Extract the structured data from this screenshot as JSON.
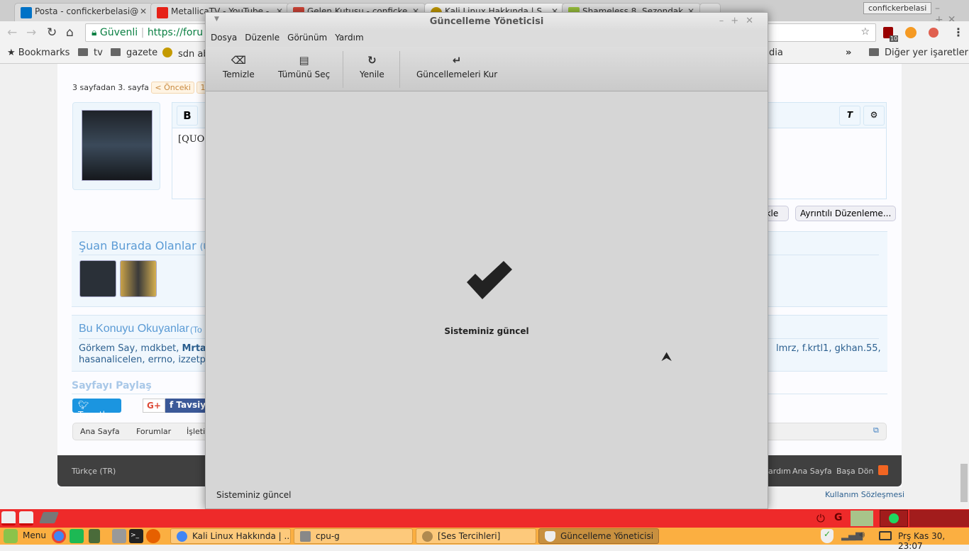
{
  "browser": {
    "tabs": [
      {
        "title": "Posta - confickerbelasi@",
        "icon": "outlook-icon",
        "color": "#0072c6"
      },
      {
        "title": "MetallicaTV - YouTube -",
        "icon": "youtube-icon",
        "color": "#e62117"
      },
      {
        "title": "Gelen Kutusu - conficke",
        "icon": "gmail-icon",
        "color": "#d44638"
      },
      {
        "title": "Kali Linux Hakkında | S",
        "icon": "kali-icon",
        "color": "#c49a00"
      },
      {
        "title": "Shameless 8. Sezondak",
        "icon": "dizi-icon",
        "color": "#9ac23c"
      }
    ],
    "profile": "confickerbelasi",
    "omnibox": {
      "secure_label": "Güvenli",
      "url": "https://foru"
    },
    "bookmarks": [
      "Bookmarks",
      "tv",
      "gazete",
      "sdn ab",
      "dia"
    ],
    "other_bookmarks": "Diğer yer işaretleri",
    "ext_badge": "10"
  },
  "forum": {
    "page_info": "3 sayfadan 3. sayfa",
    "prev": "< Önceki",
    "page1": "1",
    "editor_text": "[QUO",
    "bold": "B",
    "buttons": {
      "upload": "ükle",
      "advanced": "Ayrıntılı Düzenleme..."
    },
    "online_title": "Şuan Burada Olanlar",
    "online_sub": "(Üye",
    "readers_title": "Bu Konuyu Okuyanlar",
    "readers_sub": "(To",
    "readers_line1": [
      "Görkem Say, mdkbet, ",
      "Mrtaltg,"
    ],
    "readers_line1_right": "lmrz, f.krtl1, gkhan.55,",
    "readers_line2": "hasanalicelen, errno, izzetpasa",
    "share_title": "Sayfayı Paylaş",
    "tweet": "Tweetle",
    "gplus": "G+",
    "fb": "Tavsiy",
    "breadcrumb": [
      "Ana Sayfa",
      "Forumlar",
      "İşletim"
    ],
    "footer": {
      "lang": "Türkçe (TR)",
      "links": [
        "ardım",
        "Ana Sayfa",
        "Başa Dön"
      ],
      "terms": "Kullanım Sözleşmesi"
    }
  },
  "dialog": {
    "title": "Güncelleme Yöneticisi",
    "menu": [
      "Dosya",
      "Düzenle",
      "Görünüm",
      "Yardım"
    ],
    "toolbar": [
      {
        "label": "Temizle",
        "icon": "clear-icon"
      },
      {
        "label": "Tümünü Seç",
        "icon": "select-all-icon"
      },
      {
        "label": "Yenile",
        "icon": "refresh-icon"
      },
      {
        "label": "Güncellemeleri Kur",
        "icon": "install-icon"
      }
    ],
    "message": "Sisteminiz güncel",
    "status": "Sisteminiz güncel"
  },
  "taskbar": {
    "menu": "Menu",
    "tasks": [
      "Kali Linux Hakkında | ...",
      "cpu-g",
      "[Ses Tercihleri]",
      "Güncelleme Yöneticisi"
    ],
    "clock": "Prş Kas 30, 23:07"
  }
}
